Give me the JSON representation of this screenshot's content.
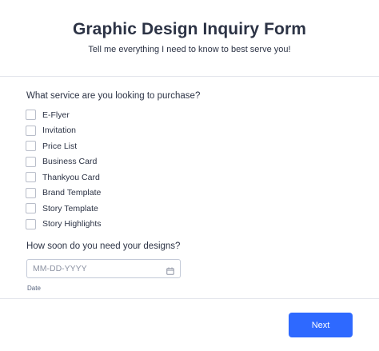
{
  "header": {
    "title": "Graphic Design Inquiry Form",
    "subtitle": "Tell me everything I need to know to best serve you!"
  },
  "service_question": {
    "label": "What service are you looking to purchase?",
    "options": [
      {
        "label": "E-Flyer",
        "checked": false
      },
      {
        "label": "Invitation",
        "checked": false
      },
      {
        "label": "Price List",
        "checked": false
      },
      {
        "label": "Business Card",
        "checked": false
      },
      {
        "label": "Thankyou Card",
        "checked": false
      },
      {
        "label": "Brand Template",
        "checked": false
      },
      {
        "label": "Story Template",
        "checked": false
      },
      {
        "label": "Story Highlights",
        "checked": false
      }
    ]
  },
  "date_question": {
    "label": "How soon do you need your designs?",
    "placeholder": "MM-DD-YYYY",
    "value": "",
    "sublabel": "Date",
    "icon": "calendar-icon"
  },
  "footer": {
    "next_label": "Next"
  },
  "colors": {
    "accent": "#2e69ff",
    "text": "#2c3345",
    "border": "#b8bdc9"
  }
}
